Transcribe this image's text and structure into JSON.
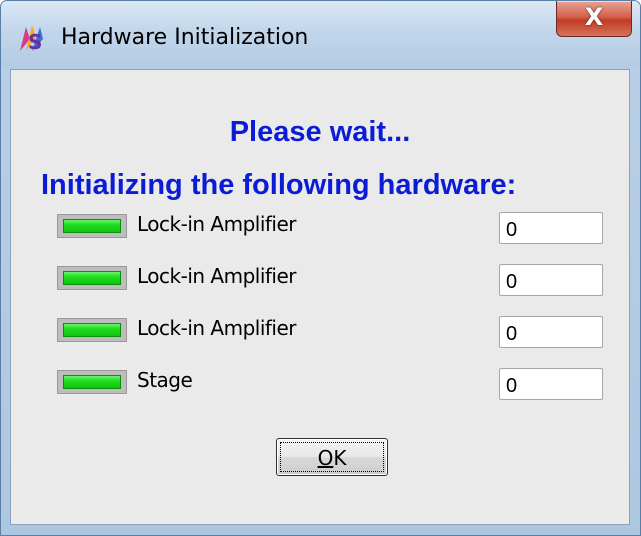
{
  "window": {
    "title": "Hardware Initialization",
    "icon": "app-logo-icon",
    "close_glyph": "X"
  },
  "dialog": {
    "heading_line1": "Please wait...",
    "heading_line2": "Initializing the following hardware:",
    "heading_color": "#0a1cd6",
    "items": [
      {
        "label": "Lock-in Amplifier",
        "status": "ok",
        "value": "0"
      },
      {
        "label": "Lock-in Amplifier",
        "status": "ok",
        "value": "0"
      },
      {
        "label": "Lock-in Amplifier",
        "status": "ok",
        "value": "0"
      },
      {
        "label": "Stage",
        "status": "ok",
        "value": "0"
      }
    ],
    "led_color": "#1edc1e",
    "ok_label": "OK"
  }
}
